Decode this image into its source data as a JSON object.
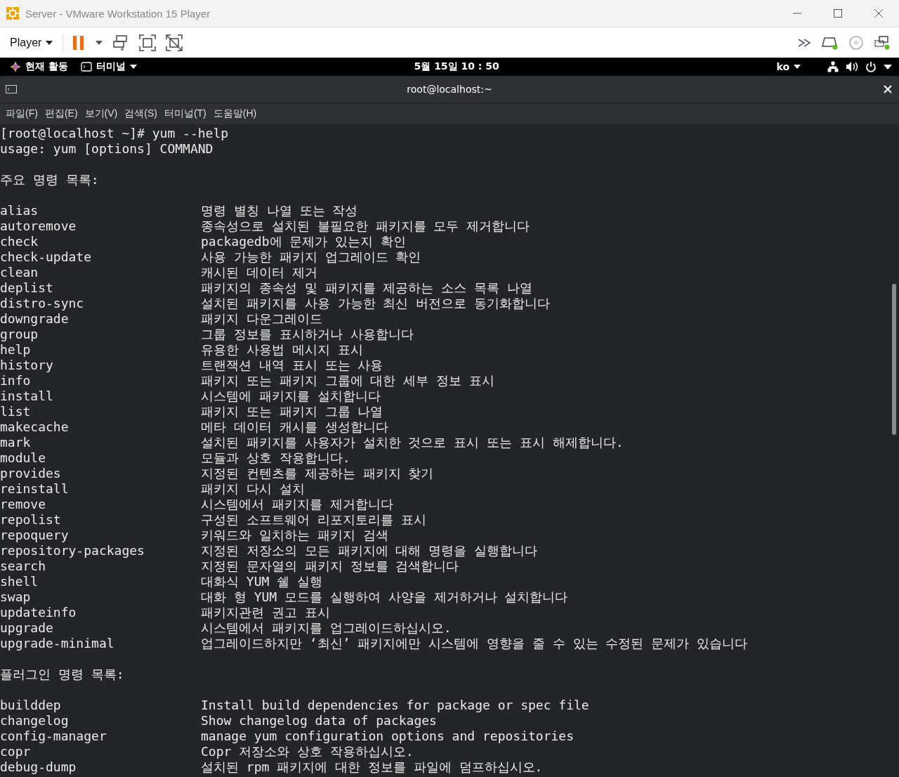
{
  "window": {
    "title": "Server - VMware Workstation 15 Player"
  },
  "toolbar": {
    "menu": "Player"
  },
  "top_bar": {
    "activities": "현재 활동",
    "app_menu": "터미널",
    "clock": "5월 15일  10 : 50",
    "input_method": "ko"
  },
  "terminal": {
    "title": "root@localhost:~",
    "menus": [
      "파일(F)",
      "편집(E)",
      "보기(V)",
      "검색(S)",
      "터미널(T)",
      "도움말(H)"
    ],
    "lines": [
      {
        "kind": "text",
        "text": "[root@localhost ~]# yum --help"
      },
      {
        "kind": "text",
        "text": "usage: yum [options] COMMAND"
      },
      {
        "kind": "blank"
      },
      {
        "kind": "text",
        "text": "주요 명령 목록:"
      },
      {
        "kind": "blank"
      },
      {
        "kind": "command",
        "name": "alias",
        "description": "명령 별칭 나열 또는 작성"
      },
      {
        "kind": "command",
        "name": "autoremove",
        "description": "종속성으로 설치된 불필요한 패키지를 모두 제거합니다"
      },
      {
        "kind": "command",
        "name": "check",
        "description": "packagedb에 문제가 있는지 확인"
      },
      {
        "kind": "command",
        "name": "check-update",
        "description": "사용 가능한 패키지 업그레이드 확인"
      },
      {
        "kind": "command",
        "name": "clean",
        "description": "캐시된 데이터 제거"
      },
      {
        "kind": "command",
        "name": "deplist",
        "description": "패키지의 종속성 및 패키지를 제공하는 소스 목록 나열"
      },
      {
        "kind": "command",
        "name": "distro-sync",
        "description": "설치된 패키지를 사용 가능한 최신 버전으로 동기화합니다"
      },
      {
        "kind": "command",
        "name": "downgrade",
        "description": "패키지 다운그레이드"
      },
      {
        "kind": "command",
        "name": "group",
        "description": "그룹 정보를 표시하거나 사용합니다"
      },
      {
        "kind": "command",
        "name": "help",
        "description": "유용한 사용법 메시지 표시"
      },
      {
        "kind": "command",
        "name": "history",
        "description": "트랜잭션 내역 표시 또는 사용"
      },
      {
        "kind": "command",
        "name": "info",
        "description": "패키지 또는 패키지 그룹에 대한 세부 정보 표시"
      },
      {
        "kind": "command",
        "name": "install",
        "description": "시스템에 패키지를 설치합니다"
      },
      {
        "kind": "command",
        "name": "list",
        "description": "패키지 또는 패키지 그룹 나열"
      },
      {
        "kind": "command",
        "name": "makecache",
        "description": "메타 데이터 캐시를 생성합니다"
      },
      {
        "kind": "command",
        "name": "mark",
        "description": "설치된 패키지를 사용자가 설치한 것으로 표시 또는 표시 해제합니다."
      },
      {
        "kind": "command",
        "name": "module",
        "description": "모듈과 상호 작용합니다."
      },
      {
        "kind": "command",
        "name": "provides",
        "description": "지정된 컨텐츠를 제공하는 패키지 찾기"
      },
      {
        "kind": "command",
        "name": "reinstall",
        "description": "패키지 다시 설치"
      },
      {
        "kind": "command",
        "name": "remove",
        "description": "시스템에서 패키지를 제거합니다"
      },
      {
        "kind": "command",
        "name": "repolist",
        "description": "구성된 소프트웨어 리포지토리를 표시"
      },
      {
        "kind": "command",
        "name": "repoquery",
        "description": "키워드와 일치하는 패키지 검색"
      },
      {
        "kind": "command",
        "name": "repository-packages",
        "description": "지정된 저장소의 모든 패키지에 대해 명령을 실행합니다"
      },
      {
        "kind": "command",
        "name": "search",
        "description": "지정된 문자열의 패키지 정보를 검색합니다"
      },
      {
        "kind": "command",
        "name": "shell",
        "description": "대화식 YUM 쉘 실행"
      },
      {
        "kind": "command",
        "name": "swap",
        "description": "대화 형 YUM 모드를 실행하여 사양을 제거하거나 설치합니다"
      },
      {
        "kind": "command",
        "name": "updateinfo",
        "description": "패키지관련 권고 표시"
      },
      {
        "kind": "command",
        "name": "upgrade",
        "description": "시스템에서 패키지를 업그레이드하십시오."
      },
      {
        "kind": "command",
        "name": "upgrade-minimal",
        "description": "업그레이드하지만 ‘최신’ 패키지에만 시스템에 영향을 줄 수 있는 수정된 문제가 있습니다"
      },
      {
        "kind": "blank"
      },
      {
        "kind": "text",
        "text": "플러그인 명령 목록:"
      },
      {
        "kind": "blank"
      },
      {
        "kind": "command",
        "name": "builddep",
        "description": "Install build dependencies for package or spec file"
      },
      {
        "kind": "command",
        "name": "changelog",
        "description": "Show changelog data of packages"
      },
      {
        "kind": "command",
        "name": "config-manager",
        "description": "manage yum configuration options and repositories"
      },
      {
        "kind": "command",
        "name": "copr",
        "description": "Copr 저장소와 상호 작용하십시오."
      },
      {
        "kind": "command",
        "name": "debug-dump",
        "description": "설치된 rpm 패키지에 대한 정보를 파일에 덤프하십시오."
      }
    ]
  }
}
